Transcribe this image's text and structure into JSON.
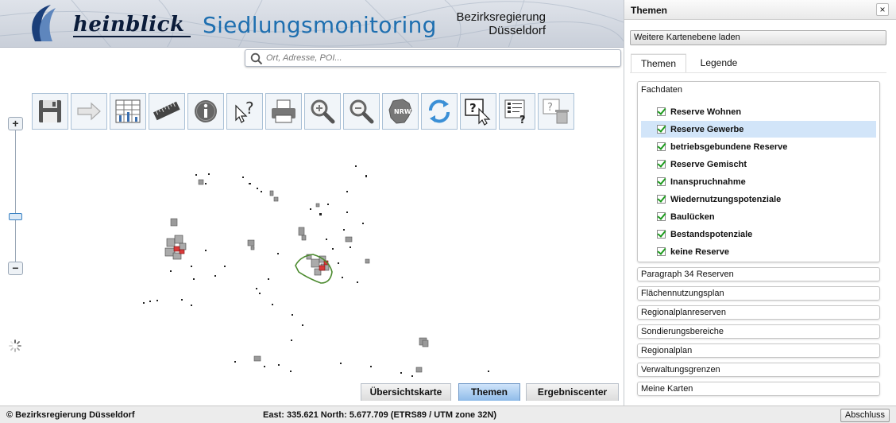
{
  "header": {
    "logo_text": "heinblick",
    "title": "Siedlungsmonitoring",
    "org_line1": "Bezirksregierung",
    "org_line2": "Düsseldorf"
  },
  "search": {
    "placeholder": "Ort, Adresse, POI..."
  },
  "toolbar": {
    "icons": [
      "save-icon",
      "arrow-right-icon",
      "table-icon",
      "ruler-icon",
      "info-icon",
      "query-icon",
      "print-icon",
      "zoom-in-icon",
      "zoom-out-icon",
      "nrw-map-icon",
      "refresh-icon",
      "help-pointer-icon",
      "help-legend-icon",
      "help-delete-icon"
    ]
  },
  "zoom": {
    "plus": "+",
    "minus": "−"
  },
  "bottom_tabs": [
    {
      "label": "Übersichtskarte",
      "active": false
    },
    {
      "label": "Themen",
      "active": true
    },
    {
      "label": "Ergebniscenter",
      "active": false
    }
  ],
  "status": {
    "copyright": "© Bezirksregierung Düsseldorf",
    "coords": "East: 335.621 North: 5.677.709 (ETRS89 / UTM zone 32N)",
    "close_label": "Abschluss"
  },
  "panel": {
    "title": "Themen",
    "close": "×",
    "load_button": "Weitere Kartenebene laden",
    "tabs": [
      {
        "label": "Themen",
        "active": true
      },
      {
        "label": "Legende",
        "active": false
      }
    ],
    "group_title": "Fachdaten",
    "layers": [
      {
        "label": "Reserve Wohnen",
        "checked": true,
        "selected": false
      },
      {
        "label": "Reserve Gewerbe",
        "checked": true,
        "selected": true
      },
      {
        "label": "betriebsgebundene Reserve",
        "checked": true,
        "selected": false
      },
      {
        "label": "Reserve Gemischt",
        "checked": true,
        "selected": false
      },
      {
        "label": "Inanspruchnahme",
        "checked": true,
        "selected": false
      },
      {
        "label": "Wiedernutzungspotenziale",
        "checked": true,
        "selected": false
      },
      {
        "label": "Baulücken",
        "checked": true,
        "selected": false
      },
      {
        "label": "Bestandspotenziale",
        "checked": true,
        "selected": false
      },
      {
        "label": "keine Reserve",
        "checked": true,
        "selected": false
      }
    ],
    "sections": [
      "Paragraph 34 Reserven",
      "Flächennutzungsplan",
      "Regionalplanreserven",
      "Sondierungsbereiche",
      "Regionalplan",
      "Verwaltungsgrenzen",
      "Meine Karten"
    ]
  },
  "colors": {
    "title_blue": "#1e6fb0",
    "selected_row": "#d2e5f9",
    "active_tab": "#8fbbe9",
    "boundary_green": "#4b8a2e",
    "parcel_red": "#d93b3b"
  }
}
